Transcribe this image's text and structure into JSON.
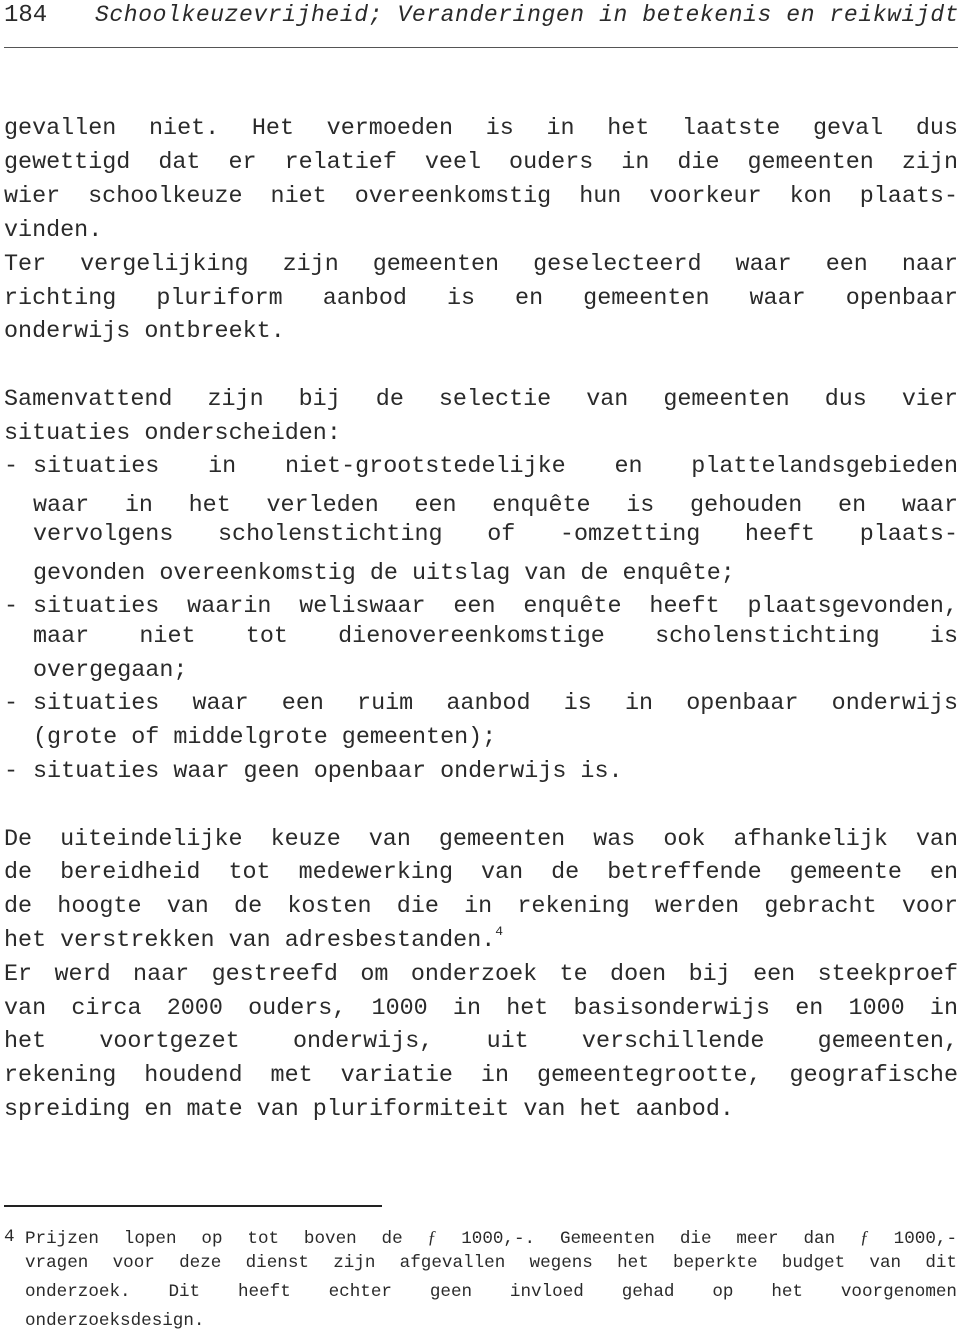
{
  "header": {
    "page_number": "184",
    "running_title": "Schoolkeuzevrijheid; Veranderingen in betekenis en reikwijdte"
  },
  "body": {
    "paragraph_1": [
      "gevallen niet. Het vermoeden is in het laatste geval dus",
      "gewettigd dat er relatief veel ouders in die gemeenten zijn",
      "wier schoolkeuze niet overeenkomstig hun voorkeur kon plaats-",
      "vinden."
    ],
    "paragraph_2": [
      "Ter vergelijking zijn gemeenten geselecteerd waar een naar",
      "richting pluriform aanbod is en gemeenten waar openbaar",
      "onderwijs ontbreekt."
    ],
    "paragraph_3": [
      "Samenvattend zijn bij de selectie van gemeenten dus vier",
      "situaties onderscheiden:"
    ],
    "list_dash": "-",
    "list_items": [
      {
        "lines": [
          "situaties in niet-grootstedelijke en plattelandsgebieden",
          "waar in het verleden een enquête is gehouden en waar",
          "vervolgens scholenstichting of -omzetting heeft plaats-",
          "gevonden overeenkomstig de uitslag van de enquête;"
        ]
      },
      {
        "lines": [
          "situaties waarin weliswaar een enquête heeft plaatsgevonden,",
          "maar niet tot dienovereenkomstige scholenstichting is",
          "overgegaan;"
        ]
      },
      {
        "lines": [
          "situaties waar een ruim aanbod is in openbaar onderwijs",
          "(grote of middelgrote gemeenten);"
        ]
      },
      {
        "lines": [
          "situaties waar geen openbaar onderwijs is."
        ]
      }
    ],
    "paragraph_4": [
      "De uiteindelijke keuze van gemeenten was ook afhankelijk van",
      "de bereidheid tot medewerking van de betreffende gemeente en",
      "de hoogte van de kosten die in rekening werden gebracht voor",
      "het verstrekken van adresbestanden."
    ],
    "footnote_ref": "4",
    "paragraph_5": [
      "Er werd naar gestreefd om onderzoek te doen bij een steekproef",
      "van circa 2000 ouders, 1000 in het basisonderwijs en 1000 in",
      "het voortgezet onderwijs, uit verschillende gemeenten,",
      "rekening houdend met variatie in gemeentegrootte, geografische",
      "spreiding en mate van pluriformiteit van het aanbod."
    ]
  },
  "footnote": {
    "number": "4",
    "line_1_a": "Prijzen lopen op tot boven de ",
    "florin": "ƒ",
    "line_1_b": " 1000,-. Gemeenten die meer dan ",
    "line_1_c": " 1000,-",
    "lines": [
      "vragen voor deze dienst zijn afgevallen wegens het beperkte budget van dit",
      "onderzoek. Dit heeft echter geen invloed gehad op het voorgenomen",
      "onderzoeksdesign."
    ]
  }
}
